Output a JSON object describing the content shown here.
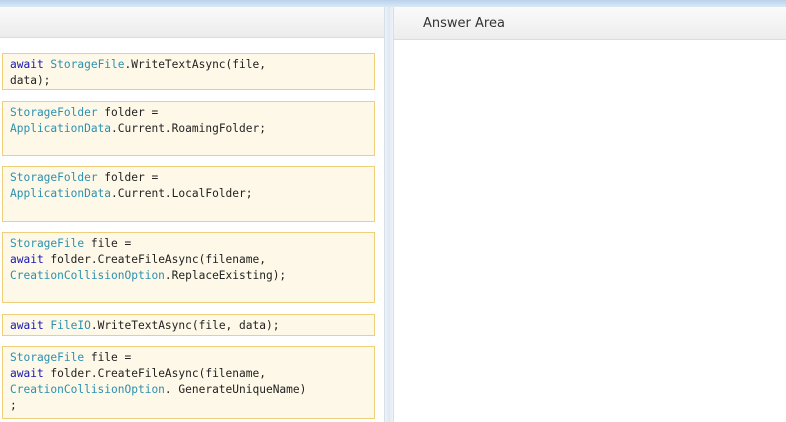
{
  "answer_area": {
    "title": "Answer Area"
  },
  "tiles": [
    {
      "id": "write-storagefile",
      "lines": [
        [
          {
            "t": "kw",
            "v": "await "
          },
          {
            "t": "ty",
            "v": "StorageFile"
          },
          {
            "t": "p",
            "v": ".WriteTextAsync(file, "
          }
        ],
        [
          {
            "t": "p",
            "v": "data);"
          }
        ]
      ]
    },
    {
      "id": "roaming-folder",
      "lines": [
        [
          {
            "t": "ty",
            "v": "StorageFolder"
          },
          {
            "t": "p",
            "v": " folder ="
          }
        ],
        [
          {
            "t": "ty",
            "v": "ApplicationData"
          },
          {
            "t": "p",
            "v": ".Current.RoamingFolder;"
          }
        ]
      ]
    },
    {
      "id": "local-folder",
      "lines": [
        [
          {
            "t": "ty",
            "v": "StorageFolder"
          },
          {
            "t": "p",
            "v": " folder ="
          }
        ],
        [
          {
            "t": "ty",
            "v": "ApplicationData"
          },
          {
            "t": "p",
            "v": ".Current.LocalFolder;"
          }
        ]
      ]
    },
    {
      "id": "create-replace",
      "lines": [
        [
          {
            "t": "ty",
            "v": "StorageFile"
          },
          {
            "t": "p",
            "v": " file ="
          }
        ],
        [
          {
            "t": "kw",
            "v": "await"
          },
          {
            "t": "p",
            "v": " folder.CreateFileAsync(filename,"
          }
        ],
        [
          {
            "t": "ty",
            "v": "CreationCollisionOption"
          },
          {
            "t": "p",
            "v": ".ReplaceExisting);"
          }
        ]
      ]
    },
    {
      "id": "write-fileio",
      "lines": [
        [
          {
            "t": "kw",
            "v": "await "
          },
          {
            "t": "ty",
            "v": "FileIO"
          },
          {
            "t": "p",
            "v": ".WriteTextAsync(file, data);"
          }
        ]
      ]
    },
    {
      "id": "create-unique",
      "lines": [
        [
          {
            "t": "ty",
            "v": "StorageFile"
          },
          {
            "t": "p",
            "v": " file ="
          }
        ],
        [
          {
            "t": "kw",
            "v": "await"
          },
          {
            "t": "p",
            "v": " folder.CreateFileAsync(filename,"
          }
        ],
        [
          {
            "t": "ty",
            "v": "CreationCollisionOption"
          },
          {
            "t": "p",
            "v": ". GenerateUniqueName)"
          }
        ],
        [
          {
            "t": "p",
            "v": ";"
          }
        ]
      ]
    }
  ]
}
